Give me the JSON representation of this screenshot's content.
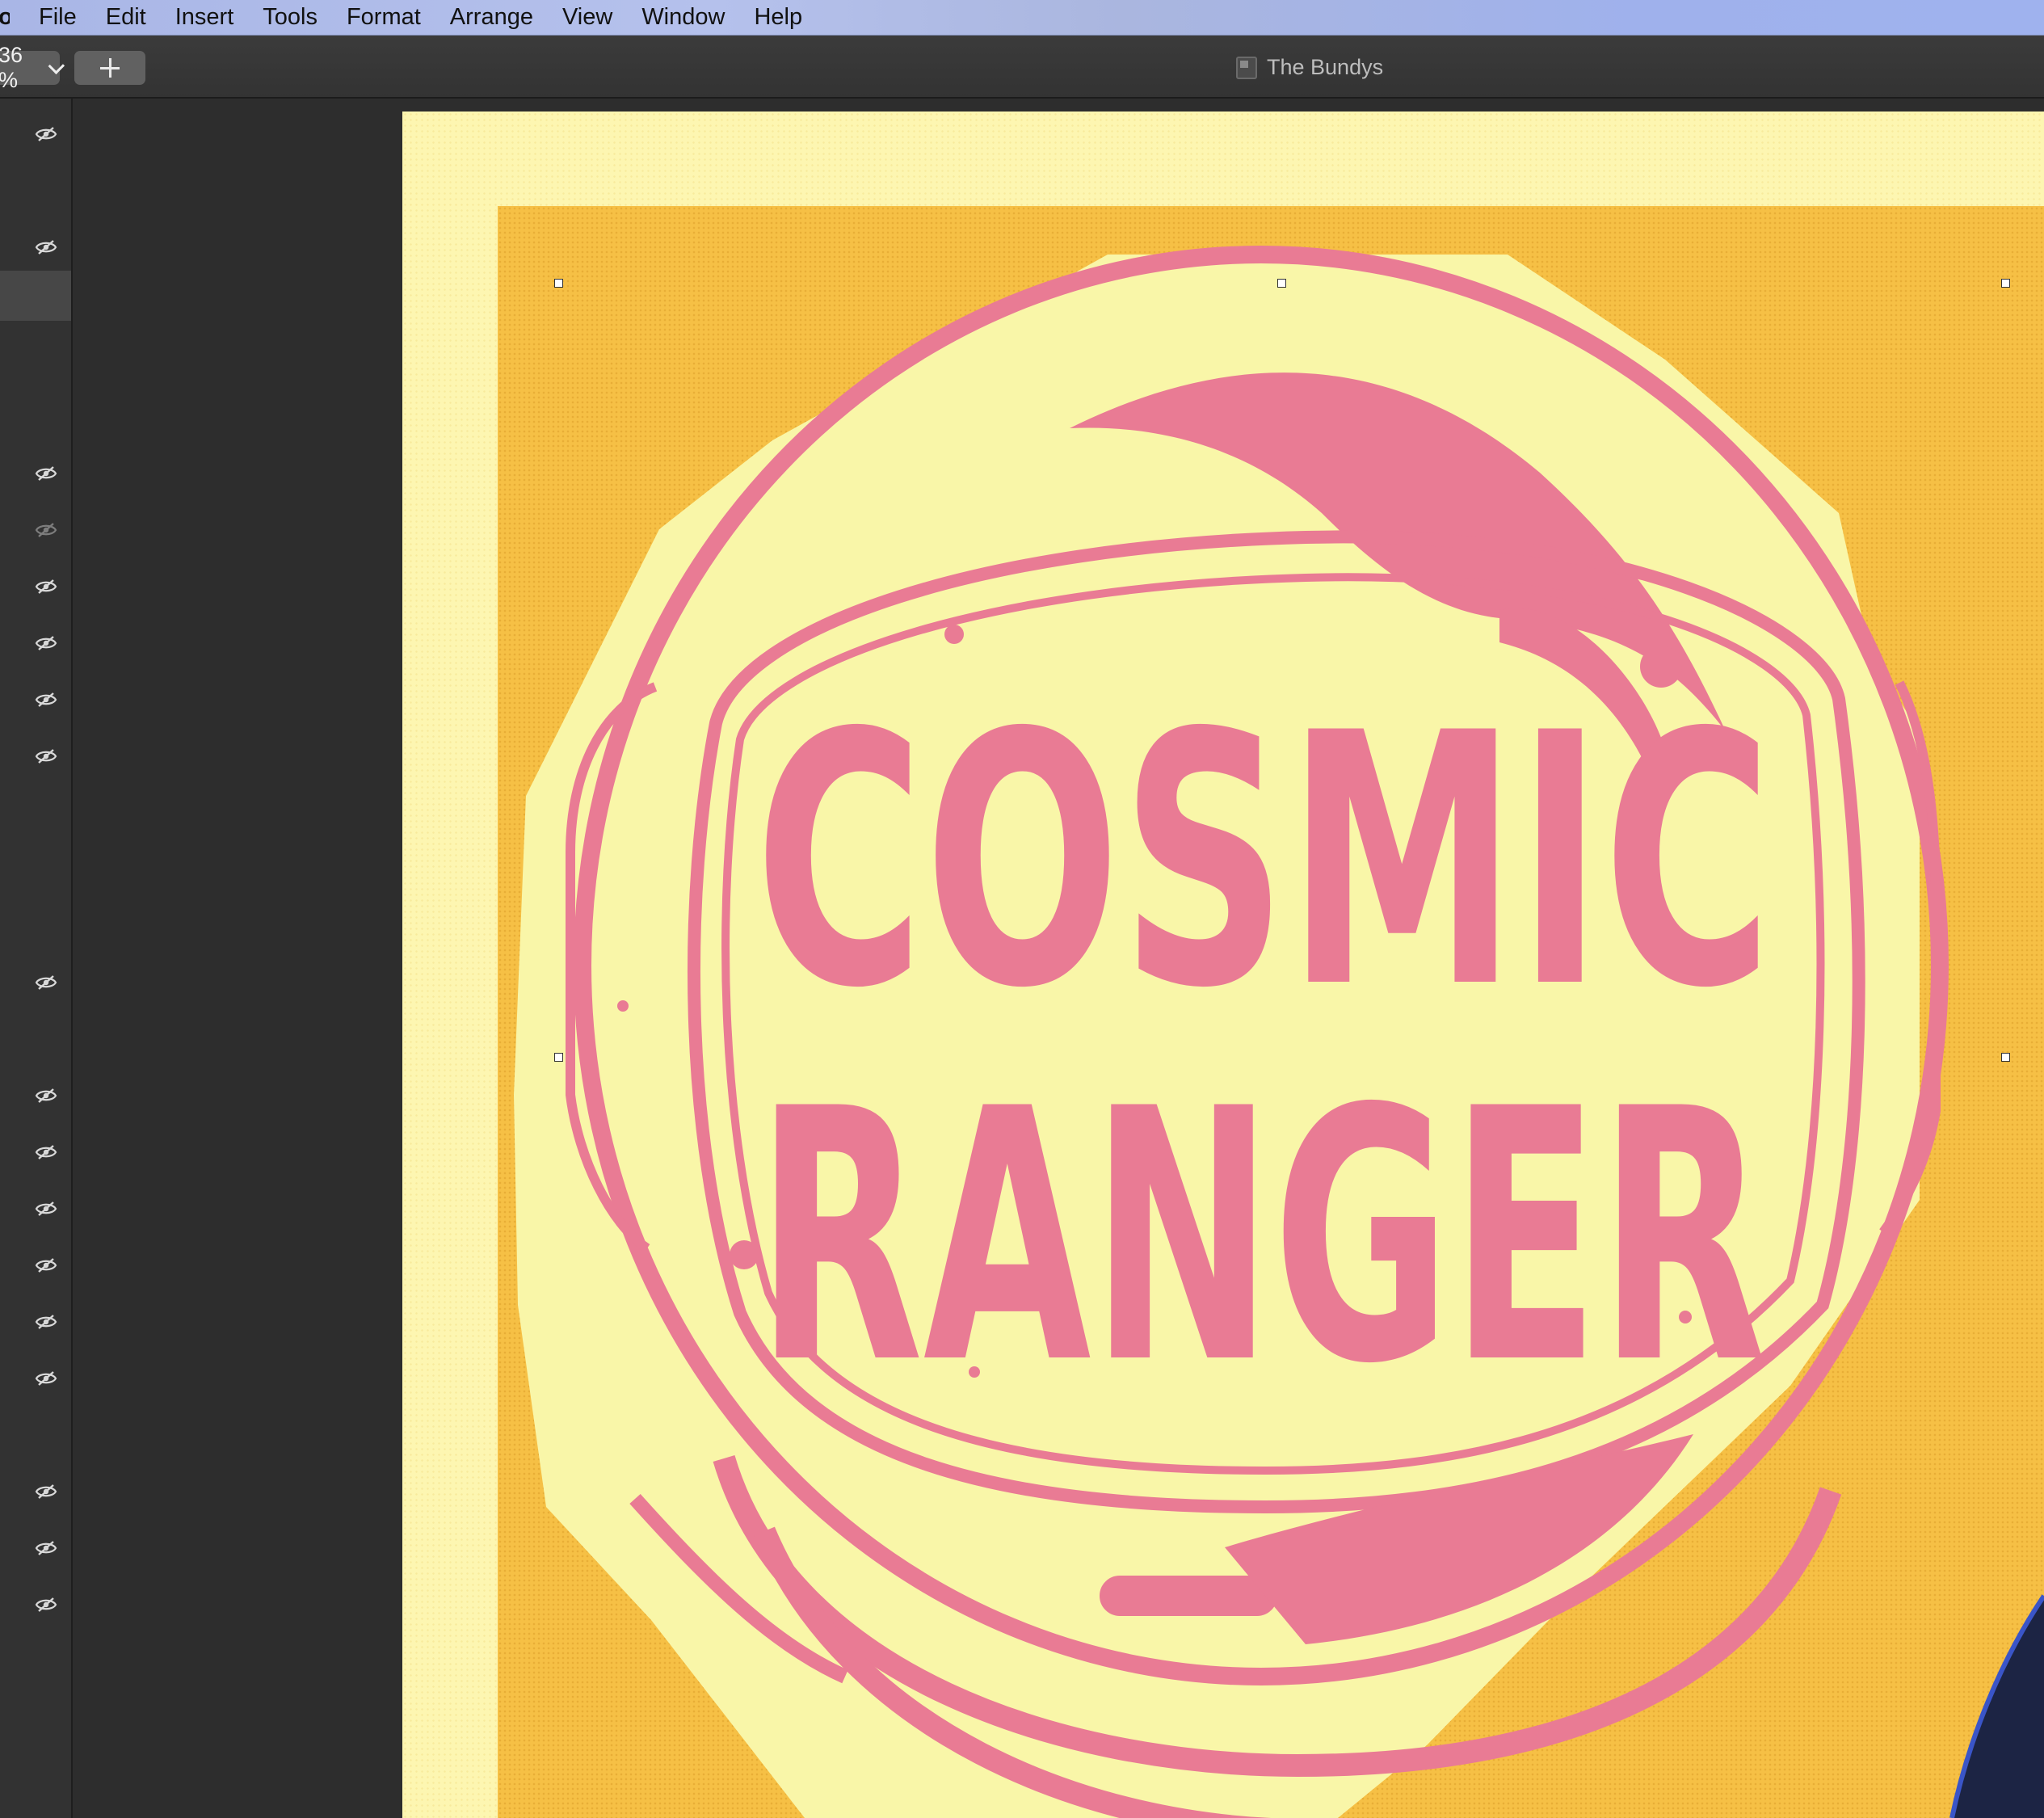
{
  "menubar": {
    "app_name": "o",
    "items": [
      "File",
      "Edit",
      "Insert",
      "Tools",
      "Format",
      "Arrange",
      "View",
      "Window",
      "Help"
    ]
  },
  "toolbar": {
    "zoom_value": "36 %",
    "add_label": "+",
    "document_title": "The Bundys"
  },
  "layers": {
    "visibility_icons": [
      {
        "icon": "eye-slash-icon",
        "dim": false
      },
      {
        "icon": "eye-slash-icon",
        "dim": false
      },
      {
        "icon": "eye-slash-icon",
        "dim": false
      },
      {
        "icon": "eye-slash-icon",
        "dim": true
      },
      {
        "icon": "eye-slash-icon",
        "dim": false
      },
      {
        "icon": "eye-slash-icon",
        "dim": false
      },
      {
        "icon": "eye-slash-icon",
        "dim": false
      },
      {
        "icon": "eye-slash-icon",
        "dim": false
      },
      {
        "icon": "eye-slash-icon",
        "dim": false
      },
      {
        "icon": "eye-slash-icon",
        "dim": false
      },
      {
        "icon": "eye-slash-icon",
        "dim": false
      },
      {
        "icon": "eye-slash-icon",
        "dim": false
      },
      {
        "icon": "eye-slash-icon",
        "dim": false
      },
      {
        "icon": "eye-slash-icon",
        "dim": false
      },
      {
        "icon": "eye-slash-icon",
        "dim": false
      },
      {
        "icon": "eye-slash-icon",
        "dim": false
      },
      {
        "icon": "eye-slash-icon",
        "dim": false
      },
      {
        "icon": "eye-slash-icon",
        "dim": false
      }
    ]
  },
  "artwork": {
    "line1": "COSMIC",
    "line2": "RANGER",
    "colors": {
      "paper": "#fdf6b1",
      "poster": "#f6c045",
      "helmet_fill": "#f9f6a8",
      "ink": "#e97b94"
    }
  }
}
